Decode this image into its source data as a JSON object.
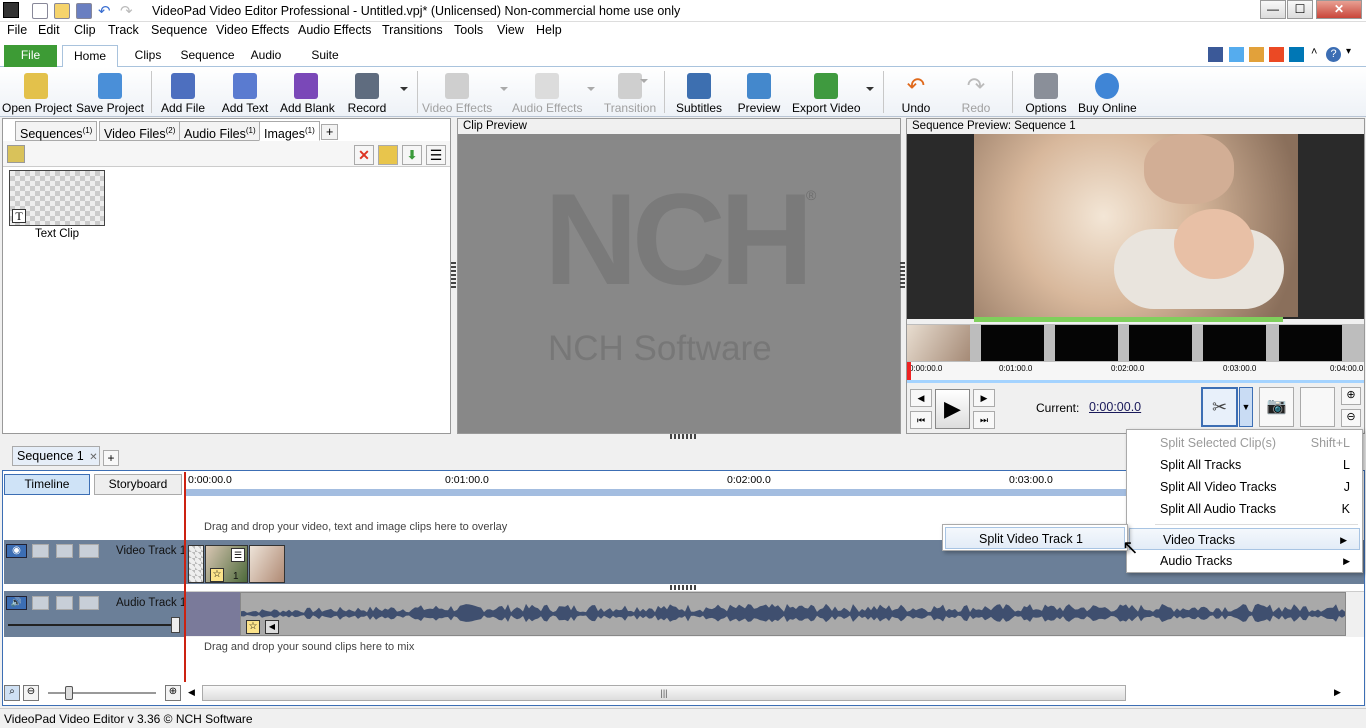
{
  "window": {
    "title": "VideoPad Video Editor Professional - Untitled.vpj* (Unlicensed) Non-commercial home use only",
    "minimize": "—",
    "maximize": "☐",
    "close": "✕"
  },
  "menubar": [
    "File",
    "Edit",
    "Clip",
    "Track",
    "Sequence",
    "Video Effects",
    "Audio Effects",
    "Transitions",
    "Tools",
    "View",
    "Help"
  ],
  "ribbon_tabs": [
    "File",
    "Home",
    "Clips",
    "Sequence",
    "Audio",
    "Suite"
  ],
  "toolbar": {
    "open_project": "Open Project",
    "save_project": "Save Project",
    "add_file": "Add File",
    "add_text": "Add Text",
    "add_blank": "Add Blank",
    "record": "Record",
    "video_effects": "Video Effects",
    "audio_effects": "Audio Effects",
    "transition": "Transition",
    "subtitles": "Subtitles",
    "preview": "Preview",
    "export_video": "Export Video",
    "undo": "Undo",
    "redo": "Redo",
    "options": "Options",
    "buy_online": "Buy Online"
  },
  "bin": {
    "tabs": [
      {
        "label": "Sequences",
        "count": "(1)"
      },
      {
        "label": "Video Files",
        "count": "(2)"
      },
      {
        "label": "Audio Files",
        "count": "(1)"
      },
      {
        "label": "Images",
        "count": "(1)"
      }
    ],
    "add_tab": "+",
    "items": [
      {
        "label": "Text Clip",
        "badge": "T"
      }
    ]
  },
  "clip_preview": {
    "title": "Clip Preview",
    "logo_text": "NCH Software",
    "logo_big": "NCH",
    "reg": "®"
  },
  "sequence_preview": {
    "title": "Sequence Preview: Sequence 1",
    "ticks": [
      "0:00:00.0",
      "0:01:00.0",
      "0:02:00.0",
      "0:03:00.0",
      "0:04:00.0"
    ],
    "current_label": "Current:",
    "current_value": "0:00:00.0"
  },
  "timeline": {
    "sequence_tab": "Sequence 1",
    "close": "✕",
    "add_tab": "+",
    "timeline_button": "Timeline",
    "storyboard_button": "Storyboard",
    "ruler": [
      "0:00:00.0",
      "0:01:00.0",
      "0:02:00.0",
      "0:03:00.0"
    ],
    "overlay_hint": "Drag and drop your video, text and image clips here to overlay",
    "video_track": "Video Track 1",
    "audio_track": "Audio Track 1",
    "audio_hint": "Drag and drop your sound clips here to mix",
    "clip_badge": "1"
  },
  "split_menu": {
    "items": [
      {
        "label": "Split Selected Clip(s)",
        "shortcut": "Shift+L",
        "disabled": true
      },
      {
        "label": "Split All Tracks",
        "shortcut": "L"
      },
      {
        "label": "Split All Video Tracks",
        "shortcut": "J"
      },
      {
        "label": "Split All Audio Tracks",
        "shortcut": "K"
      },
      {
        "label": "Video Tracks",
        "shortcut": "▶"
      },
      {
        "label": "Audio Tracks",
        "shortcut": "▶"
      }
    ],
    "submenu": [
      "Split Video Track 1"
    ]
  },
  "status": "VideoPad Video Editor v 3.36 © NCH Software",
  "colors": {
    "accent_blue": "#3c6eb4",
    "file_tab_green": "#3d9b35",
    "track_bg": "#6b7f98",
    "audio_wave": "#3f4f6f"
  }
}
